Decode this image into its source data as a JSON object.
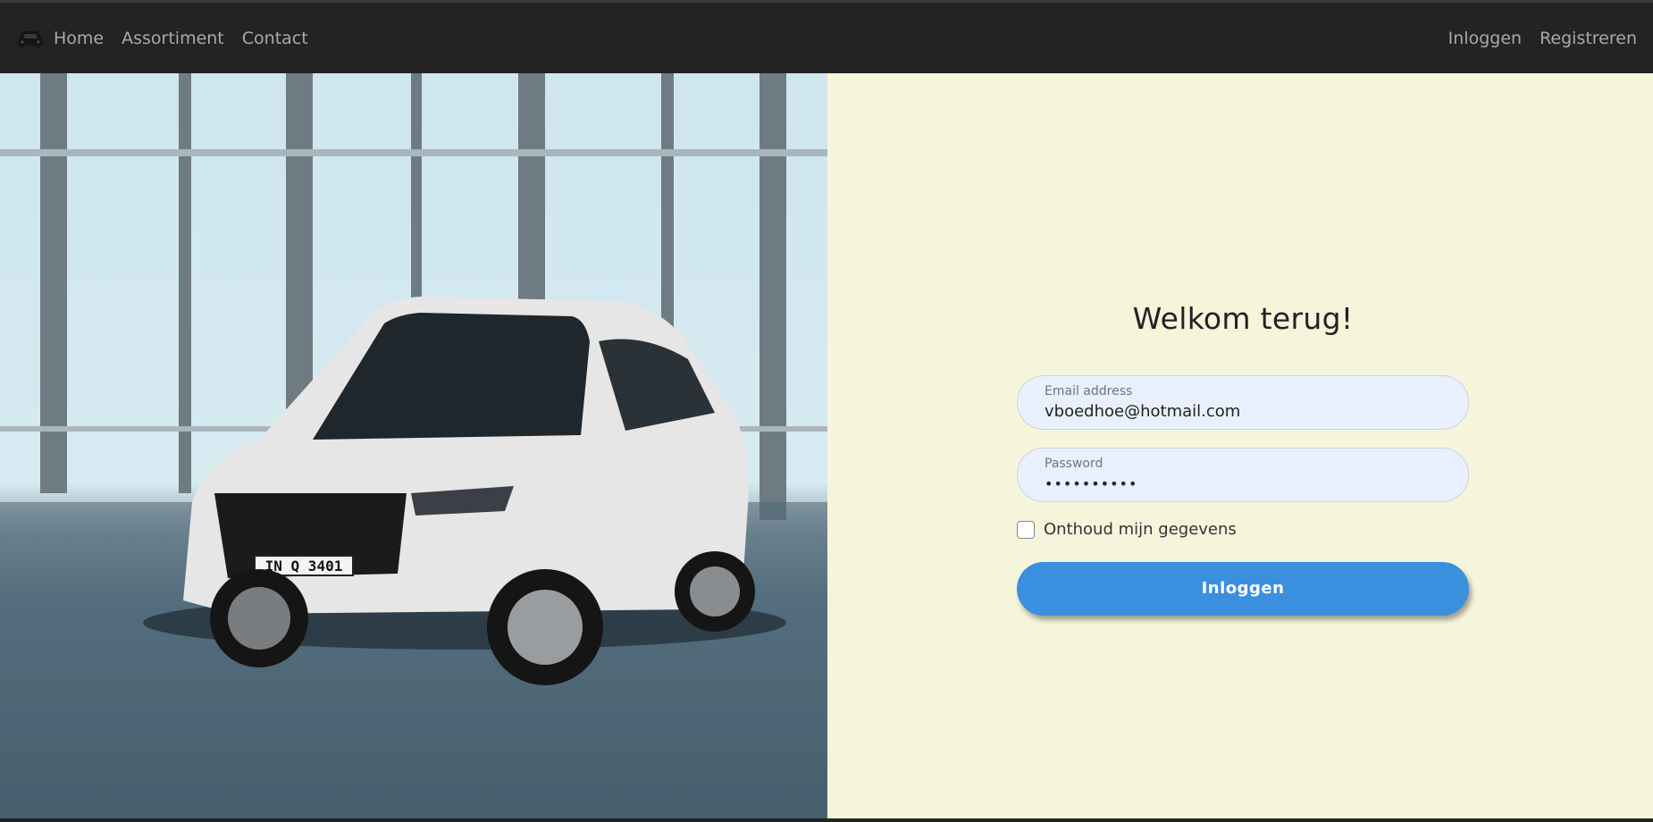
{
  "nav": {
    "brand_icon": "car-icon",
    "links": [
      "Home",
      "Assortiment",
      "Contact"
    ],
    "right_links": [
      "Inloggen",
      "Registreren"
    ]
  },
  "hero": {
    "image": "white-suv-showroom",
    "license_plate": "IN Q 3401"
  },
  "login": {
    "title": "Welkom terug!",
    "email_label": "Email address",
    "email_value": "vboedhoe@hotmail.com",
    "password_label": "Password",
    "password_value": "••••••••••",
    "remember_label": "Onthoud mijn gegevens",
    "remember_checked": false,
    "submit_label": "Inloggen"
  },
  "colors": {
    "navbar": "#232323",
    "panel": "#f5f5dc",
    "button": "#3a8fde",
    "input": "#e8f0fe"
  }
}
